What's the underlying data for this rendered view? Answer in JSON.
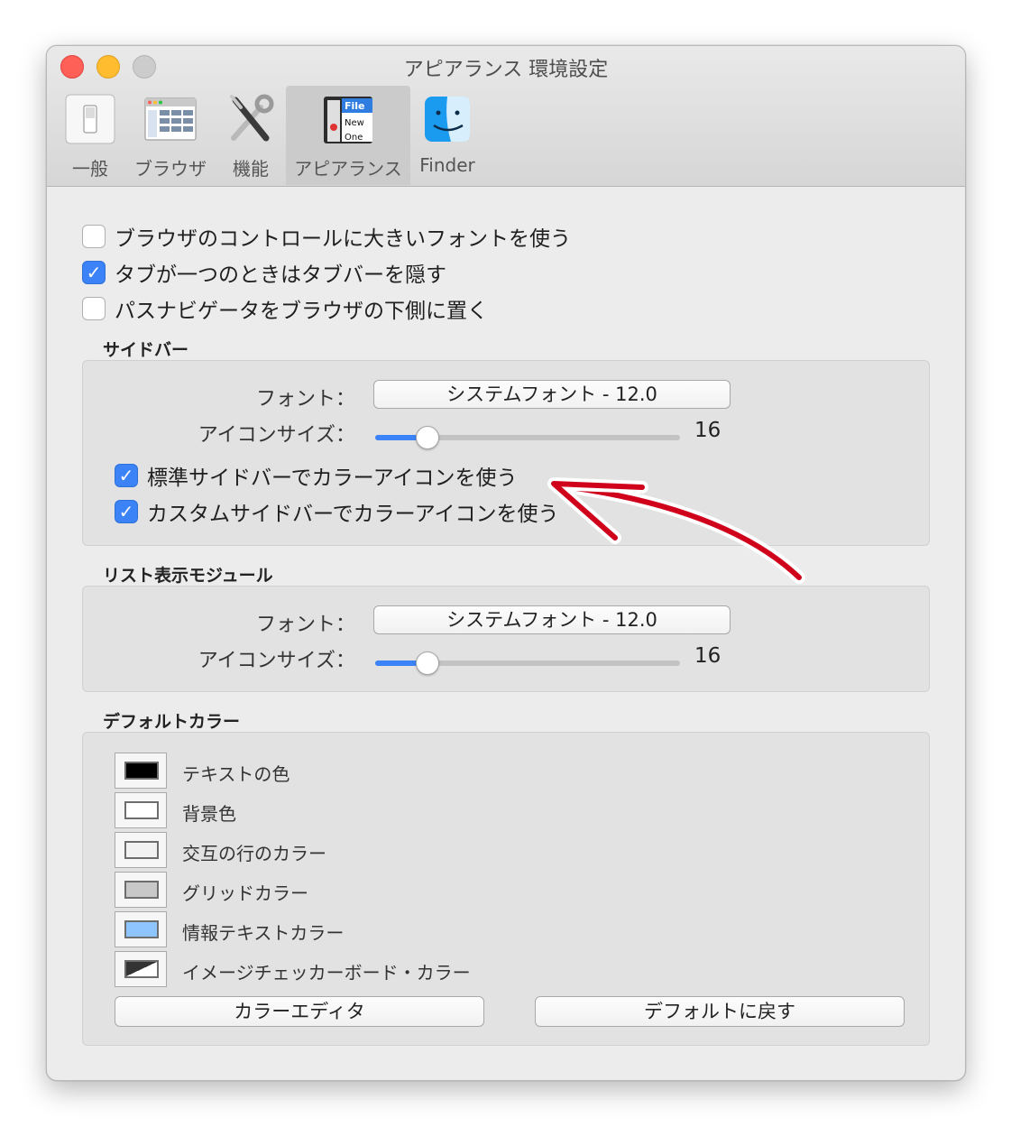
{
  "window": {
    "title": "アピアランス 環境設定"
  },
  "toolbar": {
    "items": [
      {
        "label": "一般",
        "icon": "switch-icon"
      },
      {
        "label": "ブラウザ",
        "icon": "browser-window-icon"
      },
      {
        "label": "機能",
        "icon": "tools-icon"
      },
      {
        "label": "アピアランス",
        "icon": "appearance-menu-icon",
        "selected": true
      },
      {
        "label": "Finder",
        "icon": "finder-icon"
      }
    ],
    "appearance_icon_text": [
      "File",
      "New",
      "One"
    ]
  },
  "general_options": [
    {
      "label": "ブラウザのコントロールに大きいフォントを使う",
      "checked": false
    },
    {
      "label": "タブが一つのときはタブバーを隠す",
      "checked": true
    },
    {
      "label": "パスナビゲータをブラウザの下側に置く",
      "checked": false
    }
  ],
  "sidebar": {
    "title": "サイドバー",
    "font_label": "フォント：",
    "font_value": "システムフォント - 12.0",
    "icon_size_label": "アイコンサイズ：",
    "icon_size_value": "16",
    "icon_size_fraction": 0.17,
    "options": [
      {
        "label": "標準サイドバーでカラーアイコンを使う",
        "checked": true
      },
      {
        "label": "カスタムサイドバーでカラーアイコンを使う",
        "checked": true
      }
    ]
  },
  "list_view": {
    "title": "リスト表示モジュール",
    "font_label": "フォント：",
    "font_value": "システムフォント - 12.0",
    "icon_size_label": "アイコンサイズ：",
    "icon_size_value": "16",
    "icon_size_fraction": 0.17
  },
  "default_colors": {
    "title": "デフォルトカラー",
    "items": [
      {
        "label": "テキストの色",
        "color": "#000000"
      },
      {
        "label": "背景色",
        "color": "#ffffff"
      },
      {
        "label": "交互の行のカラー",
        "color": "#f2f2f2"
      },
      {
        "label": "グリッドカラー",
        "color": "#c8c8c8"
      },
      {
        "label": "情報テキストカラー",
        "color": "#8ec5ff"
      },
      {
        "label": "イメージチェッカーボード・カラー",
        "color": "#ffffff",
        "secondary_color": "#333333"
      }
    ],
    "color_editor_button": "カラーエディタ",
    "restore_defaults_button": "デフォルトに戻す"
  },
  "colors": {
    "accent": "#3b83f6",
    "annotation_arrow": "#d0021b"
  }
}
